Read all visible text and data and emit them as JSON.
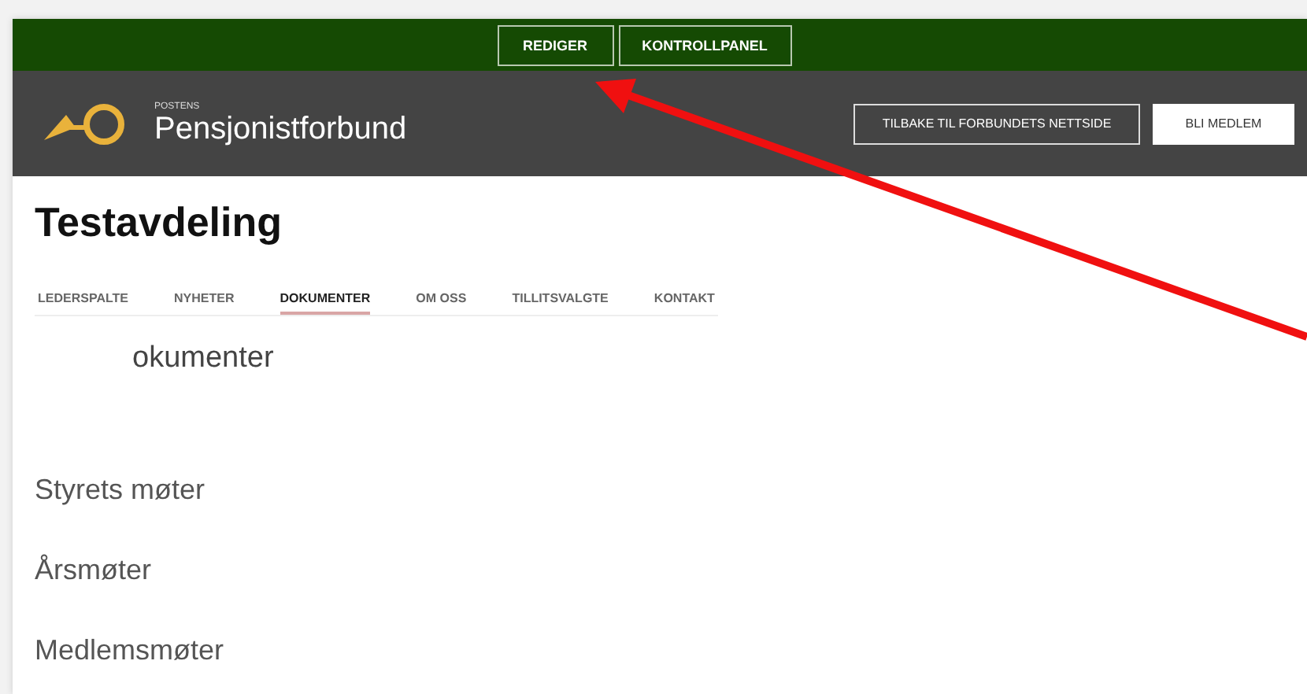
{
  "admin_bar": {
    "buttons": [
      "REDIGER",
      "KONTROLLPANEL"
    ]
  },
  "header": {
    "logo_small": "POSTENS",
    "logo_name": "Pensjonistforbund",
    "buttons": [
      {
        "label": "TILBAKE TIL FORBUNDETS NETTSIDE",
        "kind": "outline"
      },
      {
        "label": "BLI MEDLEM",
        "kind": "filled"
      }
    ]
  },
  "page_title": "Testavdeling",
  "tabs": [
    {
      "label": "LEDERSPALTE",
      "selected": false
    },
    {
      "label": "NYHETER",
      "selected": false
    },
    {
      "label": "DOKUMENTER",
      "selected": true
    },
    {
      "label": "OM OSS",
      "selected": false
    },
    {
      "label": "TILLITSVALGTE",
      "selected": false
    },
    {
      "label": "KONTAKT",
      "selected": false
    }
  ],
  "section_heading": "okumenter",
  "links": [
    "Styrets møter",
    "Årsmøter",
    "Medlemsmøter"
  ]
}
